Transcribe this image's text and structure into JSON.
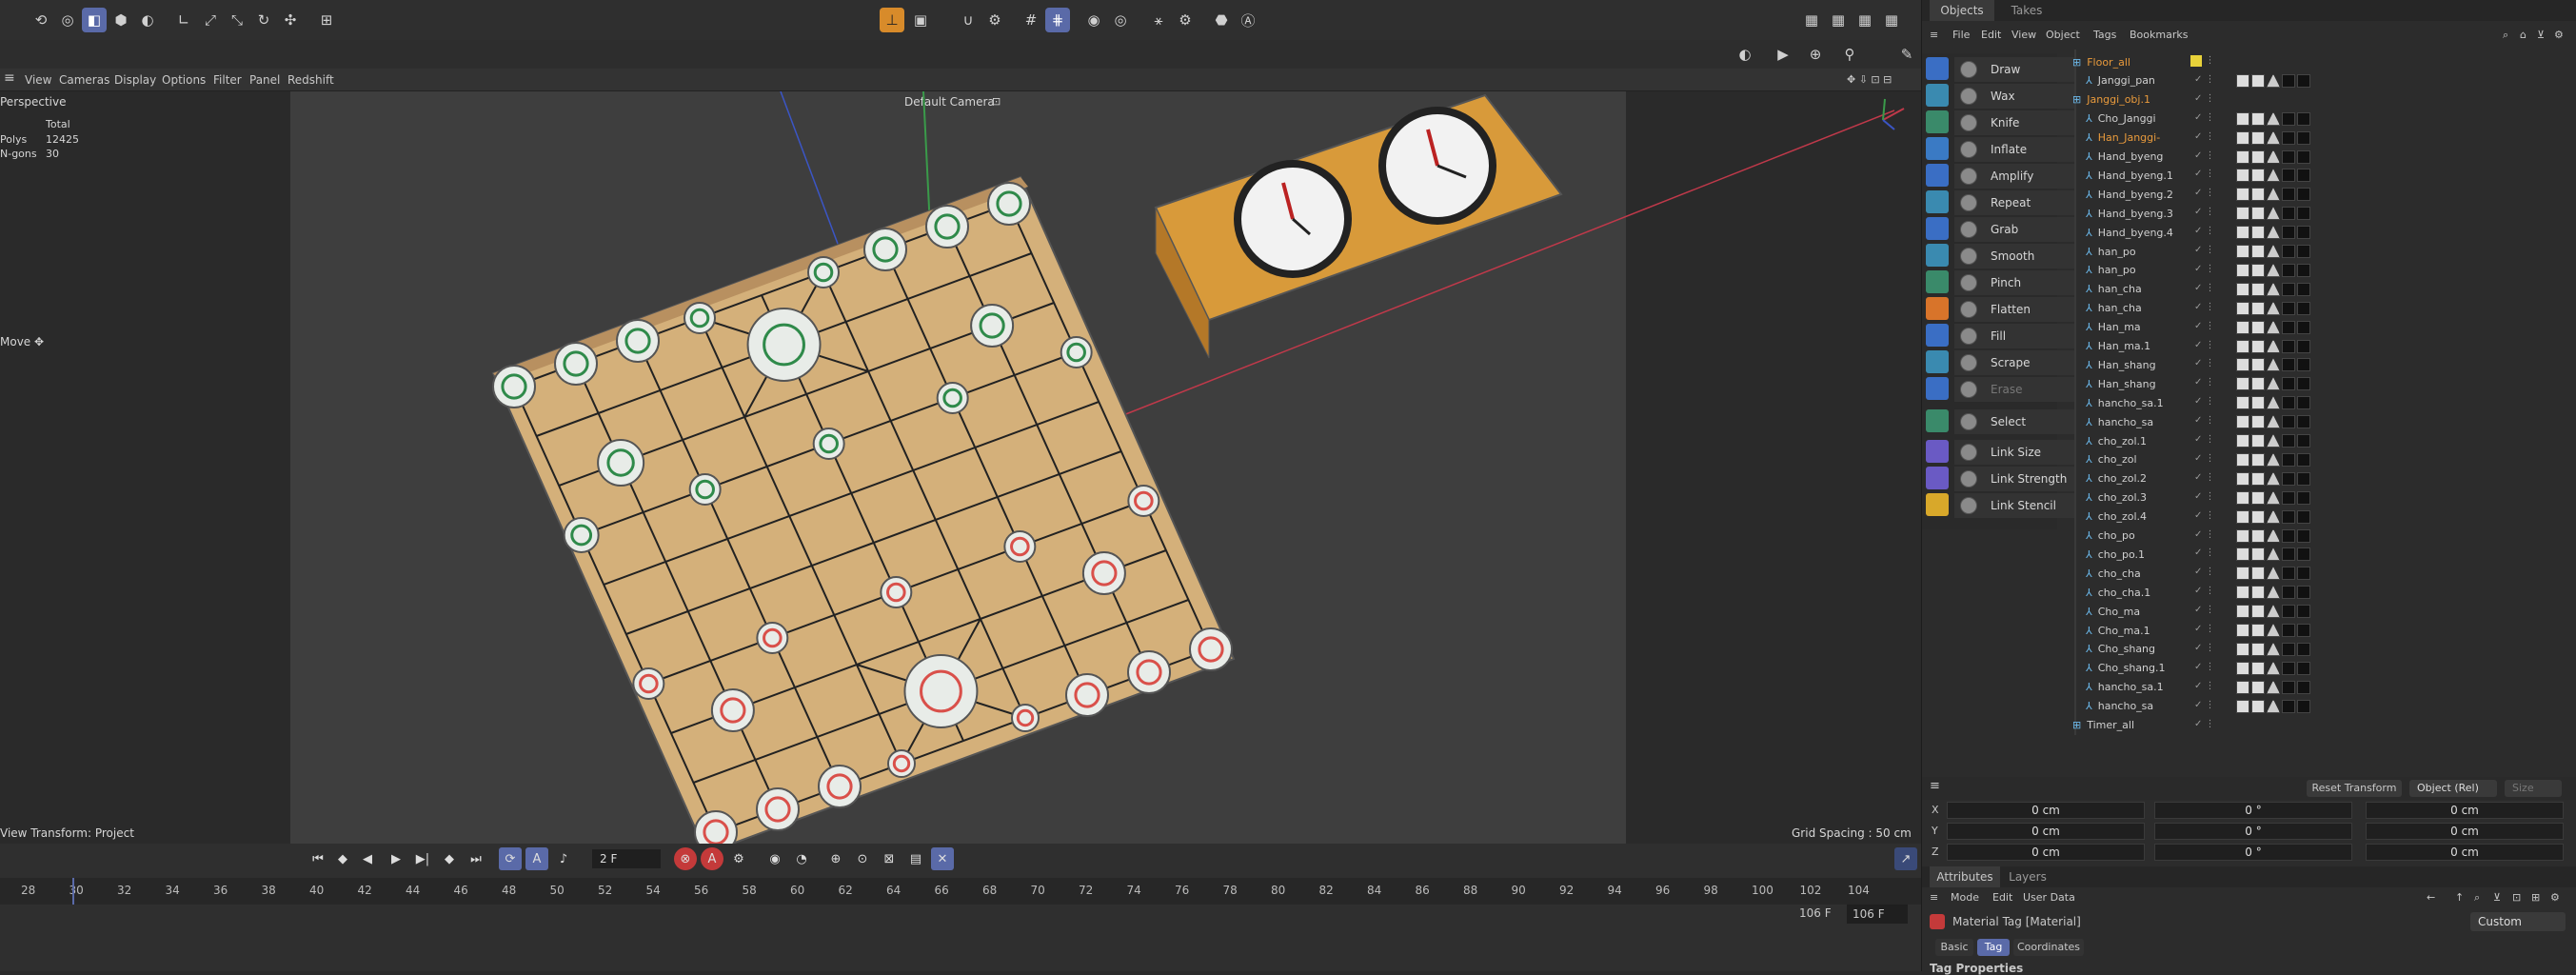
{
  "viewport": {
    "menu": [
      "View",
      "Cameras",
      "Display",
      "Options",
      "Filter",
      "Panel",
      "Redshift"
    ],
    "label": "Perspective",
    "camera": "Default Camera",
    "stats": {
      "header": "Total",
      "polys_label": "Polys",
      "polys_value": "12425",
      "ngons_label": "N-gons",
      "ngons_value": "30"
    },
    "tool": "Move",
    "view_transform": "View Transform: Project",
    "grid_spacing": "Grid Spacing : 50 cm"
  },
  "timeline": {
    "frame": "2 F",
    "end1": "106 F",
    "end2": "106 F",
    "ticks": [
      "28",
      "30",
      "32",
      "34",
      "36",
      "38",
      "40",
      "42",
      "44",
      "46",
      "48",
      "50",
      "52",
      "54",
      "56",
      "58",
      "60",
      "62",
      "64",
      "66",
      "68",
      "70",
      "72",
      "74",
      "76",
      "78",
      "80",
      "82",
      "84",
      "86",
      "88",
      "90",
      "92",
      "94",
      "96",
      "98",
      "100",
      "102",
      "104"
    ]
  },
  "sculpt_tools": [
    "Draw",
    "Wax",
    "Knife",
    "Inflate",
    "Amplify",
    "Repeat",
    "Grab",
    "Smooth",
    "Pinch",
    "Flatten",
    "Fill",
    "Scrape",
    "Erase",
    "Select",
    "Link Size",
    "Link Strength",
    "Link Stencil"
  ],
  "objects_panel": {
    "tabs": [
      "Objects",
      "Takes"
    ],
    "menu": [
      "File",
      "Edit",
      "View",
      "Object",
      "Tags",
      "Bookmarks"
    ],
    "tree": [
      {
        "name": "Floor_all",
        "color": "#e89a3c"
      },
      {
        "name": "Janggi_pan",
        "color": "#d0d0d0"
      },
      {
        "name": "Janggi_obj.1",
        "color": "#e89a3c"
      },
      {
        "name": "Cho_Janggi",
        "color": "#d0d0d0"
      },
      {
        "name": "Han_Janggi-",
        "color": "#e89a3c"
      },
      {
        "name": "Hand_byeng",
        "color": "#d0d0d0"
      },
      {
        "name": "Hand_byeng.1",
        "color": "#d0d0d0"
      },
      {
        "name": "Hand_byeng.2",
        "color": "#d0d0d0"
      },
      {
        "name": "Hand_byeng.3",
        "color": "#d0d0d0"
      },
      {
        "name": "Hand_byeng.4",
        "color": "#d0d0d0"
      },
      {
        "name": "han_po",
        "color": "#d0d0d0"
      },
      {
        "name": "han_po",
        "color": "#d0d0d0"
      },
      {
        "name": "han_cha",
        "color": "#d0d0d0"
      },
      {
        "name": "han_cha",
        "color": "#d0d0d0"
      },
      {
        "name": "Han_ma",
        "color": "#d0d0d0"
      },
      {
        "name": "Han_ma.1",
        "color": "#d0d0d0"
      },
      {
        "name": "Han_shang",
        "color": "#d0d0d0"
      },
      {
        "name": "Han_shang",
        "color": "#d0d0d0"
      },
      {
        "name": "hancho_sa.1",
        "color": "#d0d0d0"
      },
      {
        "name": "hancho_sa",
        "color": "#d0d0d0"
      },
      {
        "name": "cho_zol.1",
        "color": "#d0d0d0"
      },
      {
        "name": "cho_zol",
        "color": "#d0d0d0"
      },
      {
        "name": "cho_zol.2",
        "color": "#d0d0d0"
      },
      {
        "name": "cho_zol.3",
        "color": "#d0d0d0"
      },
      {
        "name": "cho_zol.4",
        "color": "#d0d0d0"
      },
      {
        "name": "cho_po",
        "color": "#d0d0d0"
      },
      {
        "name": "cho_po.1",
        "color": "#d0d0d0"
      },
      {
        "name": "cho_cha",
        "color": "#d0d0d0"
      },
      {
        "name": "cho_cha.1",
        "color": "#d0d0d0"
      },
      {
        "name": "Cho_ma",
        "color": "#d0d0d0"
      },
      {
        "name": "Cho_ma.1",
        "color": "#d0d0d0"
      },
      {
        "name": "Cho_shang",
        "color": "#d0d0d0"
      },
      {
        "name": "Cho_shang.1",
        "color": "#d0d0d0"
      },
      {
        "name": "hancho_sa.1",
        "color": "#d0d0d0"
      },
      {
        "name": "hancho_sa",
        "color": "#d0d0d0"
      },
      {
        "name": "Timer_all",
        "color": "#d0d0d0"
      }
    ]
  },
  "coords": {
    "reset_transform": "Reset Transform",
    "mode": "Object (Rel)",
    "size": "Size",
    "rows": [
      {
        "axis": "X",
        "pos": "0 cm",
        "rot": "0 °",
        "scale": "0 cm"
      },
      {
        "axis": "Y",
        "pos": "0 cm",
        "rot": "0 °",
        "scale": "0 cm"
      },
      {
        "axis": "Z",
        "pos": "0 cm",
        "rot": "0 °",
        "scale": "0 cm"
      }
    ]
  },
  "attributes": {
    "tabs": [
      "Attributes",
      "Layers"
    ],
    "menu": [
      "Mode",
      "Edit",
      "User Data"
    ],
    "title": "Material Tag [Material]",
    "preset": "Custom",
    "subtabs": [
      "Basic",
      "Tag",
      "Coordinates"
    ],
    "section": "Tag Properties"
  },
  "colors": {
    "accent": "#5a6aa8",
    "orange": "#e89a3c",
    "board": "#d4b07a",
    "red": "#d9504a",
    "green": "#2f8a4a"
  }
}
